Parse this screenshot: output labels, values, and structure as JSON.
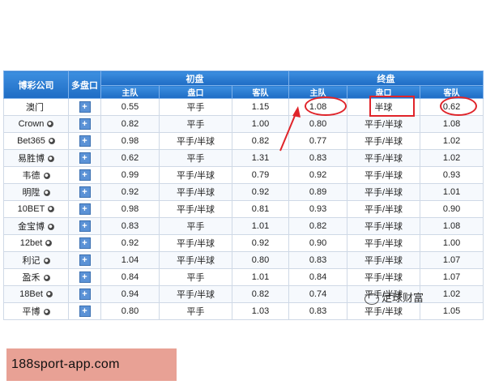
{
  "table": {
    "headers": {
      "company": "博彩公司",
      "multi": "多盘口",
      "initial": "初盘",
      "final": "终盘",
      "home": "主队",
      "handicap": "盘口",
      "away": "客队"
    },
    "plus_symbol": "+",
    "rows": [
      {
        "company": "澳门",
        "ball": false,
        "i_home": "0.55",
        "i_hcp": "平手",
        "i_away": "1.15",
        "f_home": "1.08",
        "f_hcp": "半球",
        "f_away": "0.62"
      },
      {
        "company": "Crown",
        "ball": true,
        "i_home": "0.82",
        "i_hcp": "平手",
        "i_away": "1.00",
        "f_home": "0.80",
        "f_hcp": "平手/半球",
        "f_away": "1.08"
      },
      {
        "company": "Bet365",
        "ball": true,
        "i_home": "0.98",
        "i_hcp": "平手/半球",
        "i_away": "0.82",
        "f_home": "0.77",
        "f_hcp": "平手/半球",
        "f_away": "1.02"
      },
      {
        "company": "易胜博",
        "ball": true,
        "i_home": "0.62",
        "i_hcp": "平手",
        "i_away": "1.31",
        "f_home": "0.83",
        "f_hcp": "平手/半球",
        "f_away": "1.02"
      },
      {
        "company": "韦德",
        "ball": true,
        "i_home": "0.99",
        "i_hcp": "平手/半球",
        "i_away": "0.79",
        "f_home": "0.92",
        "f_hcp": "平手/半球",
        "f_away": "0.93"
      },
      {
        "company": "明陞",
        "ball": true,
        "i_home": "0.92",
        "i_hcp": "平手/半球",
        "i_away": "0.92",
        "f_home": "0.89",
        "f_hcp": "平手/半球",
        "f_away": "1.01"
      },
      {
        "company": "10BET",
        "ball": true,
        "i_home": "0.98",
        "i_hcp": "平手/半球",
        "i_away": "0.81",
        "f_home": "0.93",
        "f_hcp": "平手/半球",
        "f_away": "0.90"
      },
      {
        "company": "金宝博",
        "ball": true,
        "i_home": "0.83",
        "i_hcp": "平手",
        "i_away": "1.01",
        "f_home": "0.82",
        "f_hcp": "平手/半球",
        "f_away": "1.08"
      },
      {
        "company": "12bet",
        "ball": true,
        "i_home": "0.92",
        "i_hcp": "平手/半球",
        "i_away": "0.92",
        "f_home": "0.90",
        "f_hcp": "平手/半球",
        "f_away": "1.00"
      },
      {
        "company": "利记",
        "ball": true,
        "i_home": "1.04",
        "i_hcp": "平手/半球",
        "i_away": "0.80",
        "f_home": "0.83",
        "f_hcp": "平手/半球",
        "f_away": "1.07"
      },
      {
        "company": "盈禾",
        "ball": true,
        "i_home": "0.84",
        "i_hcp": "平手",
        "i_away": "1.01",
        "f_home": "0.84",
        "f_hcp": "平手/半球",
        "f_away": "1.07"
      },
      {
        "company": "18Bet",
        "ball": true,
        "i_home": "0.94",
        "i_hcp": "平手/半球",
        "i_away": "0.82",
        "f_home": "0.74",
        "f_hcp": "平手/半球",
        "f_away": "1.02"
      },
      {
        "company": "平博",
        "ball": true,
        "i_home": "0.80",
        "i_hcp": "平手",
        "i_away": "1.03",
        "f_home": "0.83",
        "f_hcp": "平手/半球",
        "f_away": "1.05"
      }
    ]
  },
  "watermark": "足球财富",
  "url_banner": "188sport-app.com",
  "colors": {
    "header": "#1e6cc4",
    "annotation": "#e0242a",
    "banner": "#e8a195"
  }
}
